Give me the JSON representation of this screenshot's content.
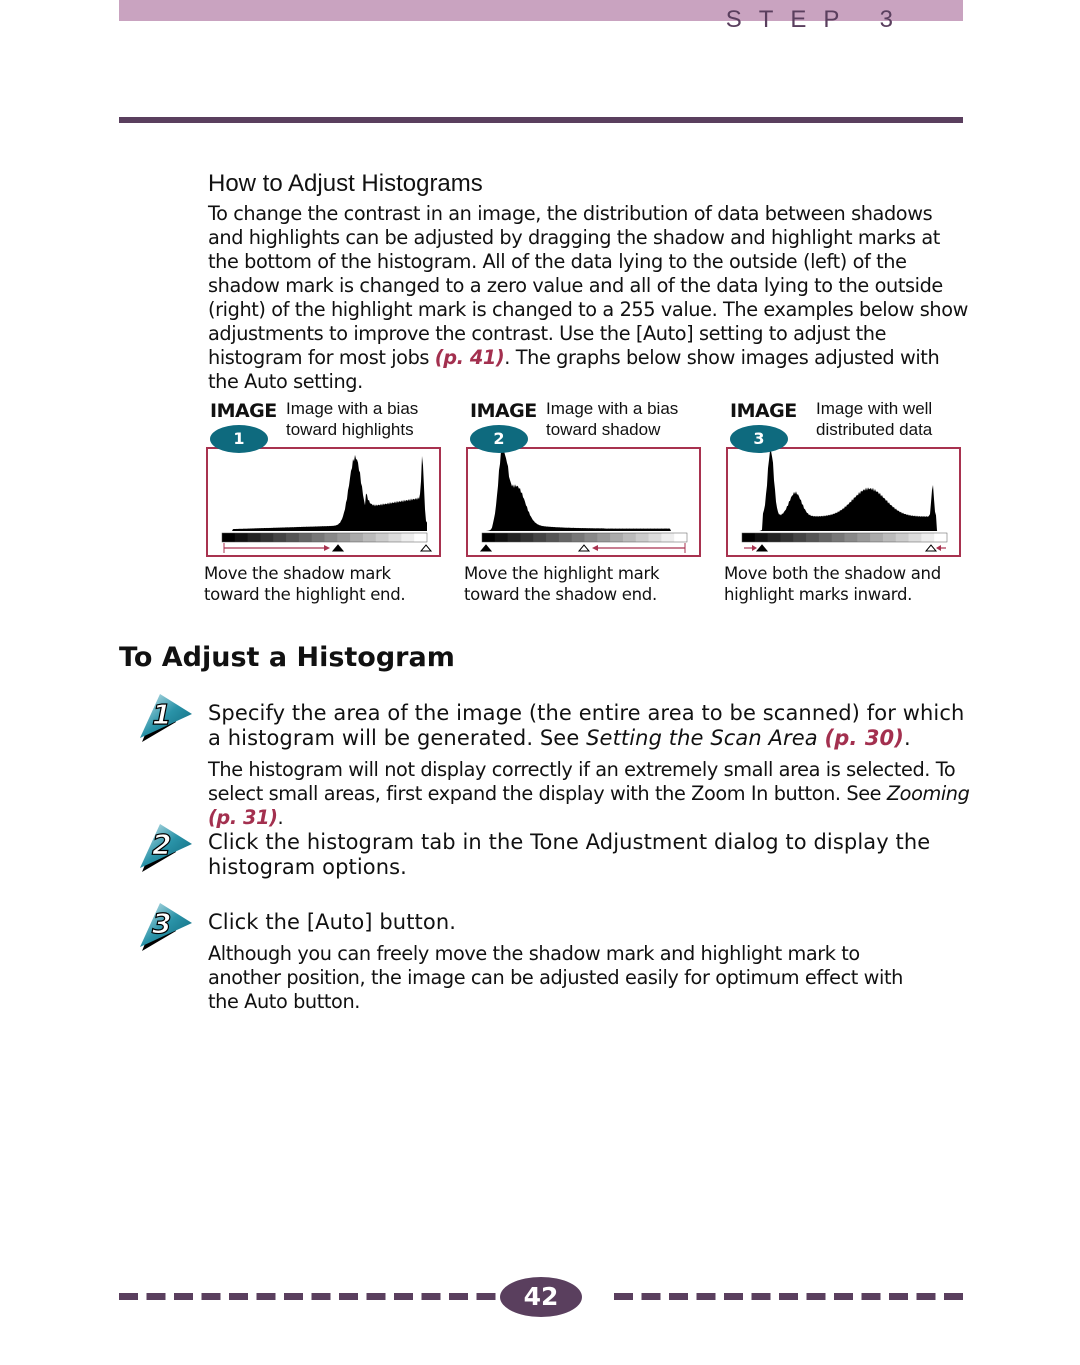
{
  "header": {
    "step_label": "STEP 3"
  },
  "section1": {
    "title": "How to Adjust Histograms",
    "body_before": "To change the contrast in an image, the distribution of data between shadows and highlights can be adjusted by dragging the shadow and highlight marks at the bottom of the histogram. All of the data lying to the outside (left) of the shadow mark is changed to a zero value and all of the data lying to the outside (right) of the highlight mark is changed to a 255 value. The examples below show adjustments to improve the contrast. Use the [Auto] setting to adjust the histogram for most jobs ",
    "link": "(p. 41)",
    "body_after": ". The graphs below show images adjusted with the Auto setting."
  },
  "figures": [
    {
      "label": "IMAGE",
      "number": "1",
      "desc1": "Image with a bias",
      "desc2": "toward highlights",
      "cap1": "Move the shadow mark",
      "cap2": "toward the highlight end."
    },
    {
      "label": "IMAGE",
      "number": "2",
      "desc1": "Image with a bias",
      "desc2": "toward shadow",
      "cap1": "Move the highlight mark",
      "cap2": "toward the shadow end."
    },
    {
      "label": "IMAGE",
      "number": "3",
      "desc1": "Image with well",
      "desc2": "distributed data",
      "cap1": "Move both the shadow and",
      "cap2": "highlight marks inward."
    }
  ],
  "section2": {
    "title": "To Adjust a Histogram",
    "steps": [
      {
        "number": "1",
        "main_a": "Specify the area of the image (the entire area to be scanned) for which a histogram will be generated. See ",
        "main_italic": "Setting the Scan Area",
        "main_link": "(p. 30)",
        "main_end": ".",
        "sub_a": "The histogram will not display correctly if an extremely small area is selected. To select small areas, first expand the display with the Zoom In button. See ",
        "sub_italic": "Zooming",
        "sub_link": "(p. 31)",
        "sub_end": "."
      },
      {
        "number": "2",
        "main_a": "Click the histogram tab in the Tone Adjustment dialog to display the histogram options."
      },
      {
        "number": "3",
        "main_a": "Click the [Auto] button.",
        "sub_a": "Although you can freely move the shadow mark and highlight mark to another position, the image can be adjusted easily for optimum effect with the Auto button."
      }
    ]
  },
  "footer": {
    "page_number": "42"
  },
  "colors": {
    "accent": "#5a3f5e",
    "topbar": "#c9a3c0",
    "link": "#a3304f",
    "teal": "#0e6a7e",
    "frame": "#a8324f"
  }
}
